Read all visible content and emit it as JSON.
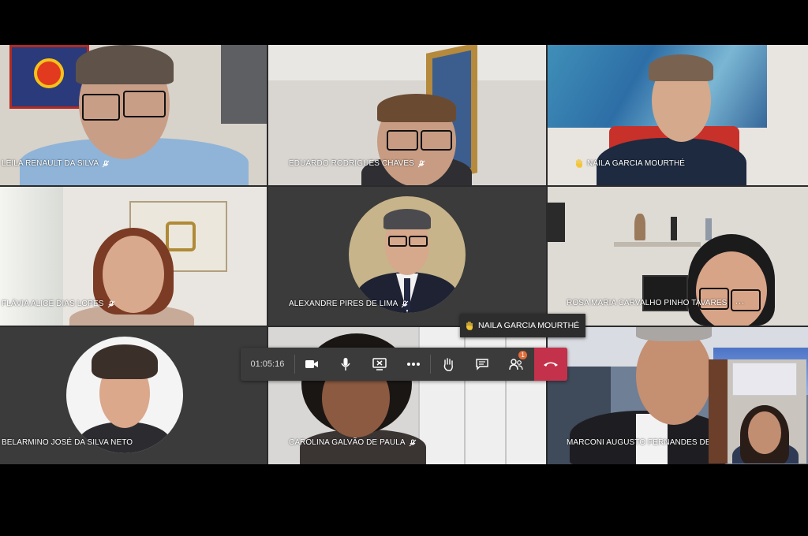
{
  "participants": [
    {
      "name": "LEILA RENAULT DA SILVA",
      "muted": true
    },
    {
      "name": "EDUARDO RODRIGUES CHAVES",
      "muted": true
    },
    {
      "name": "NAILA GARCIA MOURTHÉ",
      "hand_raised": true
    },
    {
      "name": "FLÁVIA ALICE DIAS LOPES",
      "muted": true
    },
    {
      "name": "ALEXANDRE PIRES DE LIMA",
      "muted": true
    },
    {
      "name": "ROSA MARIA CARVALHO PINHO TAVARES",
      "more": "···"
    },
    {
      "name": "BELARMINO JOSÉ DA SILVA NETO"
    },
    {
      "name": "CAROLINA GALVÃO DE PAULA",
      "muted": true
    },
    {
      "name": "MARCONI AUGUSTO FERNANDES DE CA"
    }
  ],
  "notification": {
    "text": "NAILA GARCIA MOURTHÉ",
    "icon": "raised-hand-icon"
  },
  "call_controls": {
    "timer": "01:05:16",
    "buttons": [
      "camera-icon",
      "microphone-icon",
      "share-screen-icon",
      "more-options-icon",
      "raise-hand-icon",
      "chat-icon",
      "participants-icon",
      "hang-up-icon"
    ],
    "participants_badge": "1"
  },
  "colors": {
    "hangup": "#c4314b",
    "badge": "#e06d3b",
    "stage": "#2b2b2b"
  }
}
